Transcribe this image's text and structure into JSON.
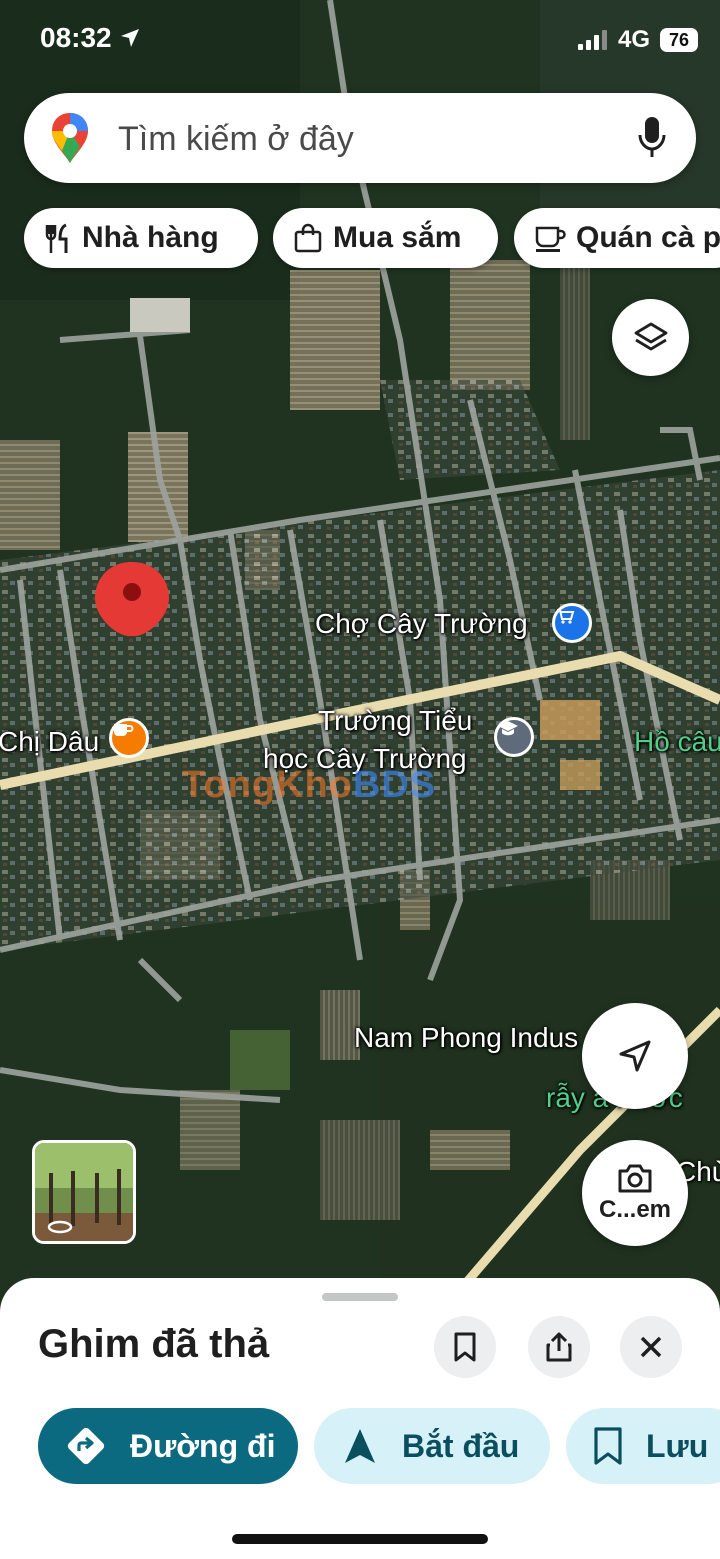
{
  "status_bar": {
    "time": "08:32",
    "network": "4G",
    "battery": "76"
  },
  "search": {
    "placeholder": "Tìm kiếm ở đây"
  },
  "chips": [
    {
      "label": "Nhà hàng",
      "icon": "restaurant-icon"
    },
    {
      "label": "Mua sắm",
      "icon": "shopping-bag-icon"
    },
    {
      "label": "Quán cà p",
      "icon": "coffee-icon"
    }
  ],
  "map": {
    "labels": {
      "market": "Chợ Cây Trường",
      "school_line1": "Trường Tiểu",
      "school_line2": "học Cây Trường",
      "cafe": "Chị Dâu",
      "lake": "Hồ câu",
      "industrial": "Nam Phong Indus",
      "green_partial": "rẫy a      nước",
      "right_partial": "Chù"
    },
    "watermark": {
      "part1": "TongKho",
      "part2": "BDS"
    },
    "colors": {
      "pin": "#e53935",
      "market_poi": "#1a73e8",
      "cafe_poi": "#f57c00",
      "school_poi": "#5f6b7a",
      "road_main": "#e9dcae"
    }
  },
  "buttons": {
    "layers_icon": "layers-icon",
    "navigate_icon": "navigation-arrow-icon",
    "camera_label": "C...em"
  },
  "sheet": {
    "title": "Ghim đã thả",
    "actions": [
      {
        "label": "Đường đi",
        "icon": "directions-icon"
      },
      {
        "label": "Bắt đầu",
        "icon": "navigation-icon"
      },
      {
        "label": "Lưu",
        "icon": "bookmark-icon"
      }
    ],
    "colors": {
      "primary": "#0b6a7f",
      "secondary_bg": "#d6f1f8",
      "secondary_text": "#0b4f5e"
    }
  }
}
